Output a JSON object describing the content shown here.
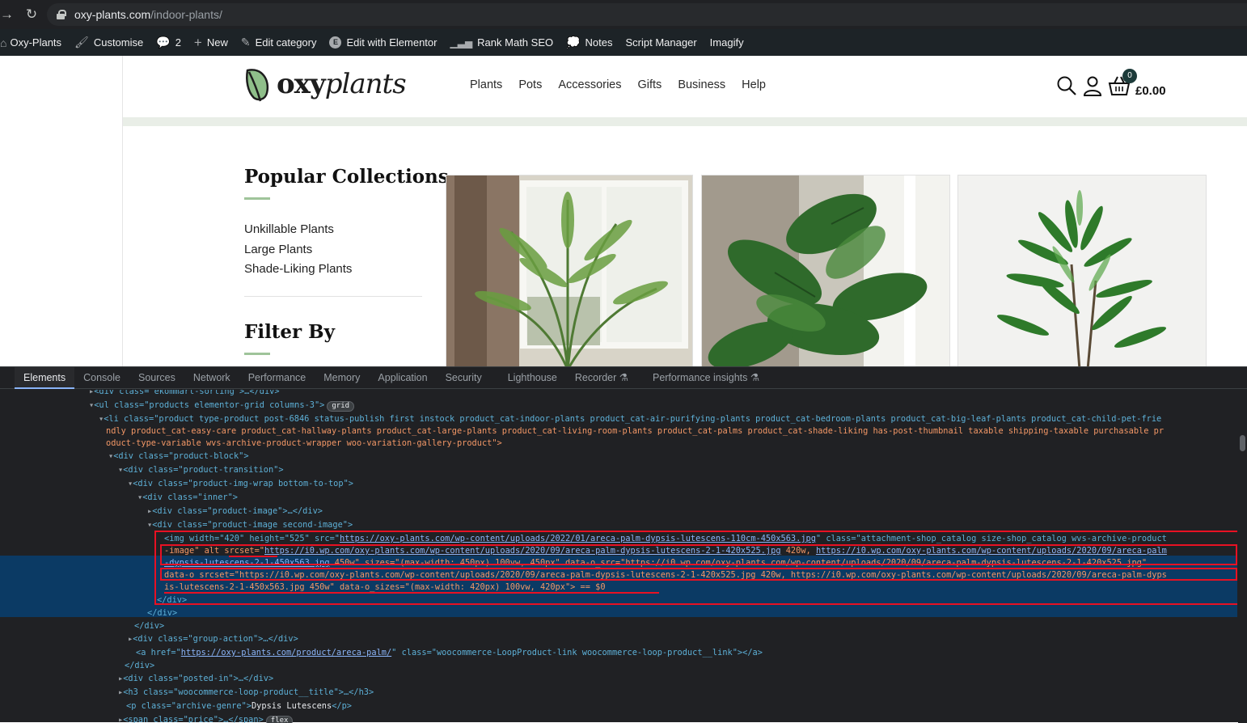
{
  "browser": {
    "url_host": "oxy-plants.com",
    "url_path": "/indoor-plants/"
  },
  "adminbar": {
    "site_name": "Oxy-Plants",
    "customise": "Customise",
    "comments_count": "2",
    "new": "New",
    "edit_category": "Edit category",
    "edit_elementor": "Edit with Elementor",
    "rank_math": "Rank Math SEO",
    "notes": "Notes",
    "script_manager": "Script Manager",
    "imagify": "Imagify"
  },
  "site": {
    "logo_bold": "oxy",
    "logo_italic": "plants",
    "nav": [
      "Plants",
      "Pots",
      "Accessories",
      "Gifts",
      "Business",
      "Help"
    ],
    "cart_count": "0",
    "cart_total": "£0.00",
    "popular_title": "Popular Collections",
    "collections": [
      "Unkillable Plants",
      "Large Plants",
      "Shade-Liking Plants"
    ],
    "filter_title": "Filter By"
  },
  "devtools": {
    "tabs": [
      "Elements",
      "Console",
      "Sources",
      "Network",
      "Performance",
      "Memory",
      "Application",
      "Security",
      "Lighthouse",
      "Recorder ⚗",
      "Performance insights ⚗"
    ],
    "pill_grid": "grid",
    "pill_flex": "flex",
    "lines": {
      "l0": "<div class=\"ekommart-sorting\">…</div>",
      "l1a": "<ul class=\"products elementor-grid columns-3\">",
      "l2a": "<li class=\"product type-product post-6846 status-publish first instock product_cat-indoor-plants product_cat-air-purifying-plants product_cat-bedroom-plants product_cat-big-leaf-plants product_cat-child-pet-frie",
      "l2b": "ndly product_cat-easy-care product_cat-hallway-plants product_cat-large-plants product_cat-living-room-plants product_cat-palms product_cat-shade-liking has-post-thumbnail taxable shipping-taxable purchasable pr",
      "l2c": "oduct-type-variable wvs-archive-product-wrapper woo-variation-gallery-product\">",
      "l3": "<div class=\"product-block\">",
      "l4": "<div class=\"product-transition\">",
      "l5": "<div class=\"product-img-wrap bottom-to-top\">",
      "l6": "<div class=\"inner\">",
      "l7": "<div class=\"product-image\">…</div>",
      "l8": "<div class=\"product-image second-image\">",
      "img1_pre": "<img width=\"420\" height=\"525\" src=\"",
      "img1_src": "https://oxy-plants.com/wp-content/uploads/2022/01/areca-palm-dypsis-lutescens-110cm-450x563.jpg",
      "img1_post": "\" class=\"attachment-shop_catalog size-shop_catalog wvs-archive-product",
      "img2_pre": "-image\" alt srcset=\"",
      "img2_link1": "https://i0.wp.com/oxy-plants.com/wp-content/uploads/2020/09/areca-palm-dypsis-lutescens-2-1-420x525.jpg",
      "img2_mid": " 420w, ",
      "img2_link2": "https://i0.wp.com/oxy-plants.com/wp-content/uploads/2020/09/areca-palm",
      "img3_link": "-dypsis-lutescens-2-1-450x563.jpg",
      "img3_post": " 450w\" sizes=\"(max-width: 450px) 100vw, 450px\" data-o_src=\"https://i0.wp.com/oxy-plants.com/wp-content/uploads/2020/09/areca-palm-dypsis-lutescens-2-1-420x525.jpg\"",
      "img4": "data-o_srcset=\"https://i0.wp.com/oxy-plants.com/wp-content/uploads/2020/09/areca-palm-dypsis-lutescens-2-1-420x525.jpg 420w, https://i0.wp.com/oxy-plants.com/wp-content/uploads/2020/09/areca-palm-dyps",
      "img5": "is-lutescens-2-1-450x563.jpg 450w\" data-o_sizes=\"(max-width: 420px) 100vw, 420px\"> == $0",
      "l10": "</div>",
      "l11": "</div>",
      "l12": "</div>",
      "l13": "<div class=\"group-action\">…</div>",
      "l14_pre": "<a href=\"",
      "l14_link": "https://oxy-plants.com/product/areca-palm/",
      "l14_post": "\" class=\"woocommerce-LoopProduct-link woocommerce-loop-product__link\"></a>",
      "l15": "</div>",
      "l16": "<div class=\"posted-in\">…</div>",
      "l17": "<h3 class=\"woocommerce-loop-product__title\">…</h3>",
      "l18_pre": "<p class=\"archive-genre\">",
      "l18_txt": "Dypsis Lutescens",
      "l18_post": "</p>",
      "l19": "<span class=\"price\">…</span>"
    }
  }
}
